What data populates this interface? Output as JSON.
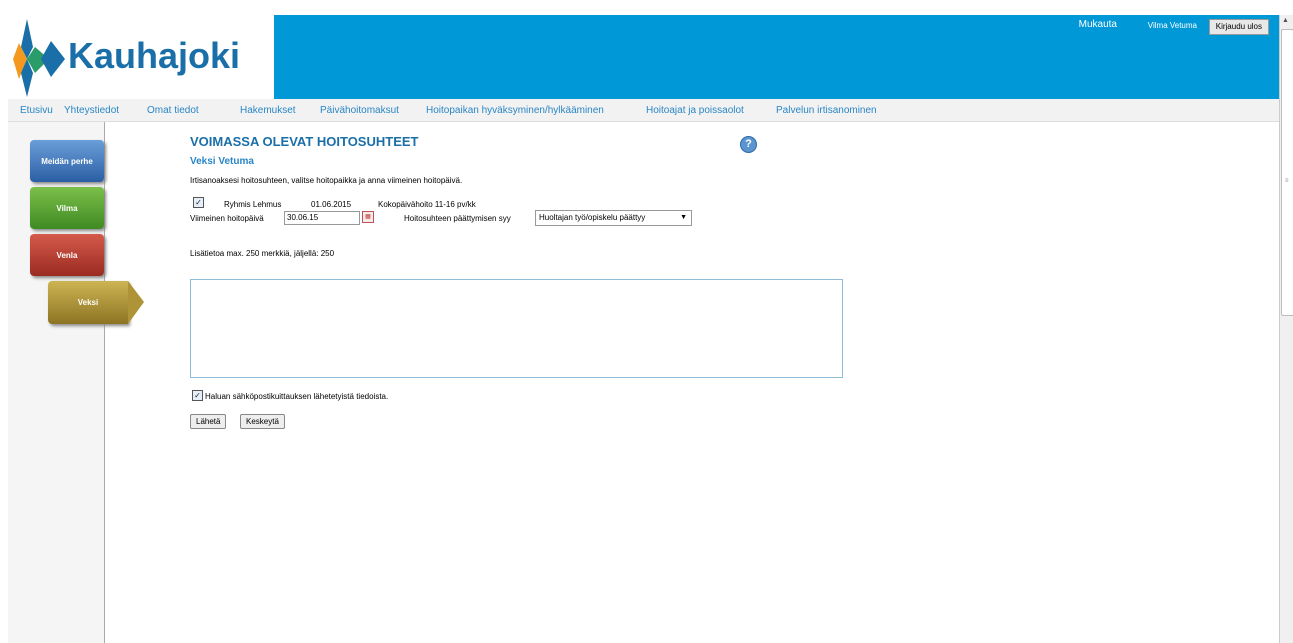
{
  "header": {
    "brand": "Kauhajoki",
    "customize_link": "Mukauta",
    "user_name": "Vilma Vetuma",
    "logout_label": "Kirjaudu ulos",
    "colors": {
      "header_bg": "#0098d6",
      "brand_text": "#1a6fa8"
    }
  },
  "nav": {
    "items": [
      {
        "label": "Etusivu"
      },
      {
        "label": "Yhteystiedot"
      },
      {
        "label": "Omat tiedot"
      },
      {
        "label": "Hakemukset"
      },
      {
        "label": "Päivähoitomaksut"
      },
      {
        "label": "Hoitopaikan hyväksyminen/hylkääminen"
      },
      {
        "label": "Hoitoajat ja poissaolot"
      },
      {
        "label": "Palvelun irtisanominen"
      }
    ]
  },
  "sidebar": {
    "tabs": [
      {
        "label": "Meidän perhe",
        "color": "#3f74bf"
      },
      {
        "label": "Vilma",
        "color": "#5aa333"
      },
      {
        "label": "Venla",
        "color": "#b8402f"
      },
      {
        "label": "Veksi",
        "color": "#ae9337",
        "active": true
      }
    ]
  },
  "main": {
    "title": "VOIMASSA OLEVAT HOITOSUHTEET",
    "help_icon": "question-icon",
    "child_name": "Veksi Vetuma",
    "instruction": "Irtisanoaksesi hoitosuhteen, valitse hoitopaikka ja anna viimeinen hoitopäivä.",
    "placement": {
      "checked": true,
      "group": "Ryhmis Lehmus",
      "start_date": "01.06.2015",
      "care_type": "Kokopäivähoito 11-16 pv/kk"
    },
    "last_day_label": "Viimeinen hoitopäivä",
    "last_day_value": "30.06.15",
    "reason_label": "Hoitosuhteen päättymisen syy",
    "reason_value": "Huoltajan työ/opiskelu päättyy",
    "extra_info_label": "Lisätietoa max. 250 merkkiä, jäljellä: 250",
    "extra_info_value": "",
    "email_confirm_checked": true,
    "email_confirm_label": "Haluan sähköpostikuittauksen lähetetyistä tiedoista.",
    "send_label": "Lähetä",
    "cancel_label": "Keskeytä"
  }
}
